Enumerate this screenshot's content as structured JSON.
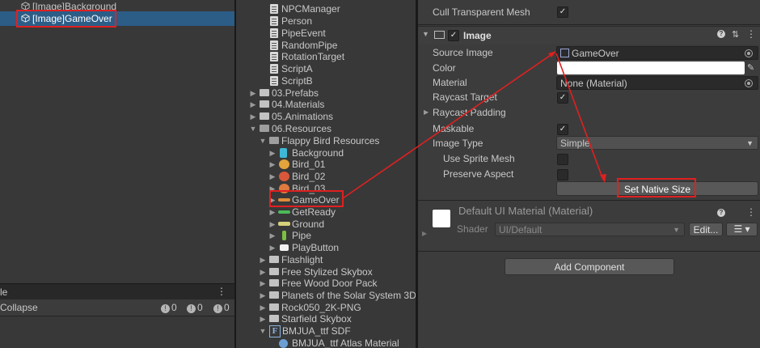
{
  "hierarchy": {
    "items": [
      {
        "label": "[Image]Background"
      },
      {
        "label": "[Image]GameOver"
      }
    ]
  },
  "console": {
    "title": "le",
    "collapse_label": "Collapse",
    "info_count": "0",
    "warn_count": "0",
    "error_count": "0"
  },
  "project": {
    "items": [
      {
        "label": "NPCManager"
      },
      {
        "label": "Person"
      },
      {
        "label": "PipeEvent"
      },
      {
        "label": "RandomPipe"
      },
      {
        "label": "RotationTarget"
      },
      {
        "label": "ScriptA"
      },
      {
        "label": "ScriptB"
      },
      {
        "label": "03.Prefabs"
      },
      {
        "label": "04.Materials"
      },
      {
        "label": "05.Animations"
      },
      {
        "label": "06.Resources"
      },
      {
        "label": "Flappy Bird Resources"
      },
      {
        "label": "Background"
      },
      {
        "label": "Bird_01"
      },
      {
        "label": "Bird_02"
      },
      {
        "label": "Bird_03"
      },
      {
        "label": "GameOver"
      },
      {
        "label": "GetReady"
      },
      {
        "label": "Ground"
      },
      {
        "label": "Pipe"
      },
      {
        "label": "PlayButton"
      },
      {
        "label": "Flashlight"
      },
      {
        "label": "Free Stylized Skybox"
      },
      {
        "label": "Free Wood Door Pack"
      },
      {
        "label": "Planets of the Solar System 3D"
      },
      {
        "label": "Rock050_2K-PNG"
      },
      {
        "label": "Starfield Skybox"
      },
      {
        "label": "BMJUA_ttf SDF"
      },
      {
        "label": "BMJUA_ttf Atlas Material"
      }
    ]
  },
  "inspector": {
    "cull_label": "Cull Transparent Mesh",
    "image_component": "Image",
    "source_image_label": "Source Image",
    "source_image_value": "GameOver",
    "color_label": "Color",
    "material_label": "Material",
    "material_value": "None (Material)",
    "raycast_target_label": "Raycast Target",
    "raycast_padding_label": "Raycast Padding",
    "maskable_label": "Maskable",
    "image_type_label": "Image Type",
    "image_type_value": "Simple",
    "use_sprite_mesh_label": "Use Sprite Mesh",
    "preserve_aspect_label": "Preserve Aspect",
    "set_native_size_label": "Set Native Size",
    "material_header": "Default UI Material (Material)",
    "shader_label": "Shader",
    "shader_value": "UI/Default",
    "edit_label": "Edit...",
    "add_component_label": "Add Component"
  },
  "colors": {
    "selection": "#2c5d87",
    "highlight_box": "#e02020"
  }
}
